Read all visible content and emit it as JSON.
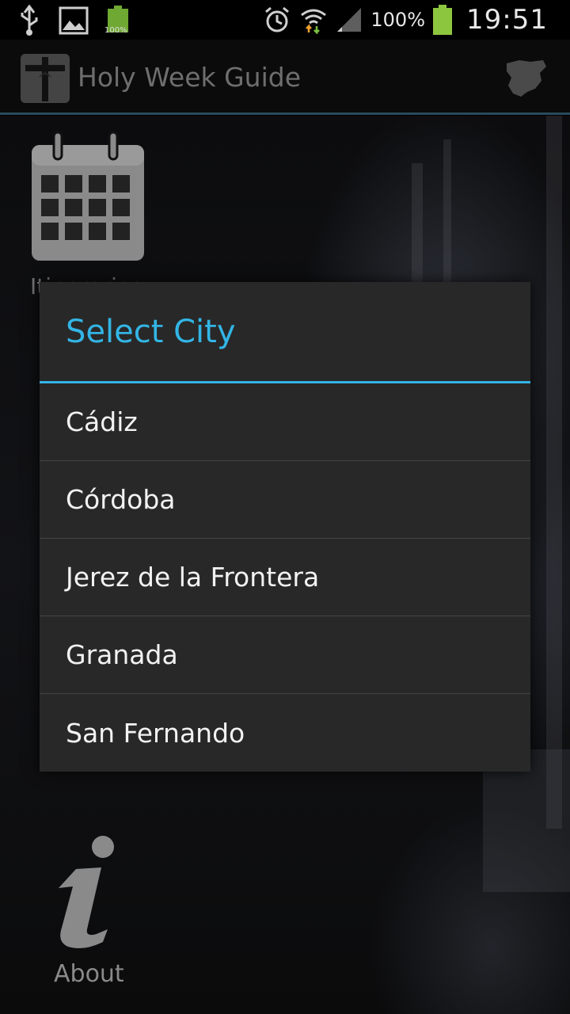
{
  "status_bar": {
    "battery_percent": "100%",
    "small_battery_label": "100%",
    "time": "19:51"
  },
  "action_bar": {
    "title": "Holy Week Guide"
  },
  "home": {
    "calendar_label": "Itinerarios",
    "about_label": "About"
  },
  "dialog": {
    "title": "Select City",
    "cities": [
      "Cádiz",
      "Córdoba",
      "Jerez de la Frontera",
      "Granada",
      "San Fernando"
    ]
  },
  "colors": {
    "accent": "#33b5e5",
    "dialog_bg": "#282828"
  },
  "icons": [
    "usb-icon",
    "image-icon",
    "battery-small-icon",
    "alarm-icon",
    "wifi-icon",
    "signal-icon",
    "battery-icon",
    "app-crucifix-icon",
    "spain-map-icon",
    "calendar-icon",
    "info-icon"
  ]
}
